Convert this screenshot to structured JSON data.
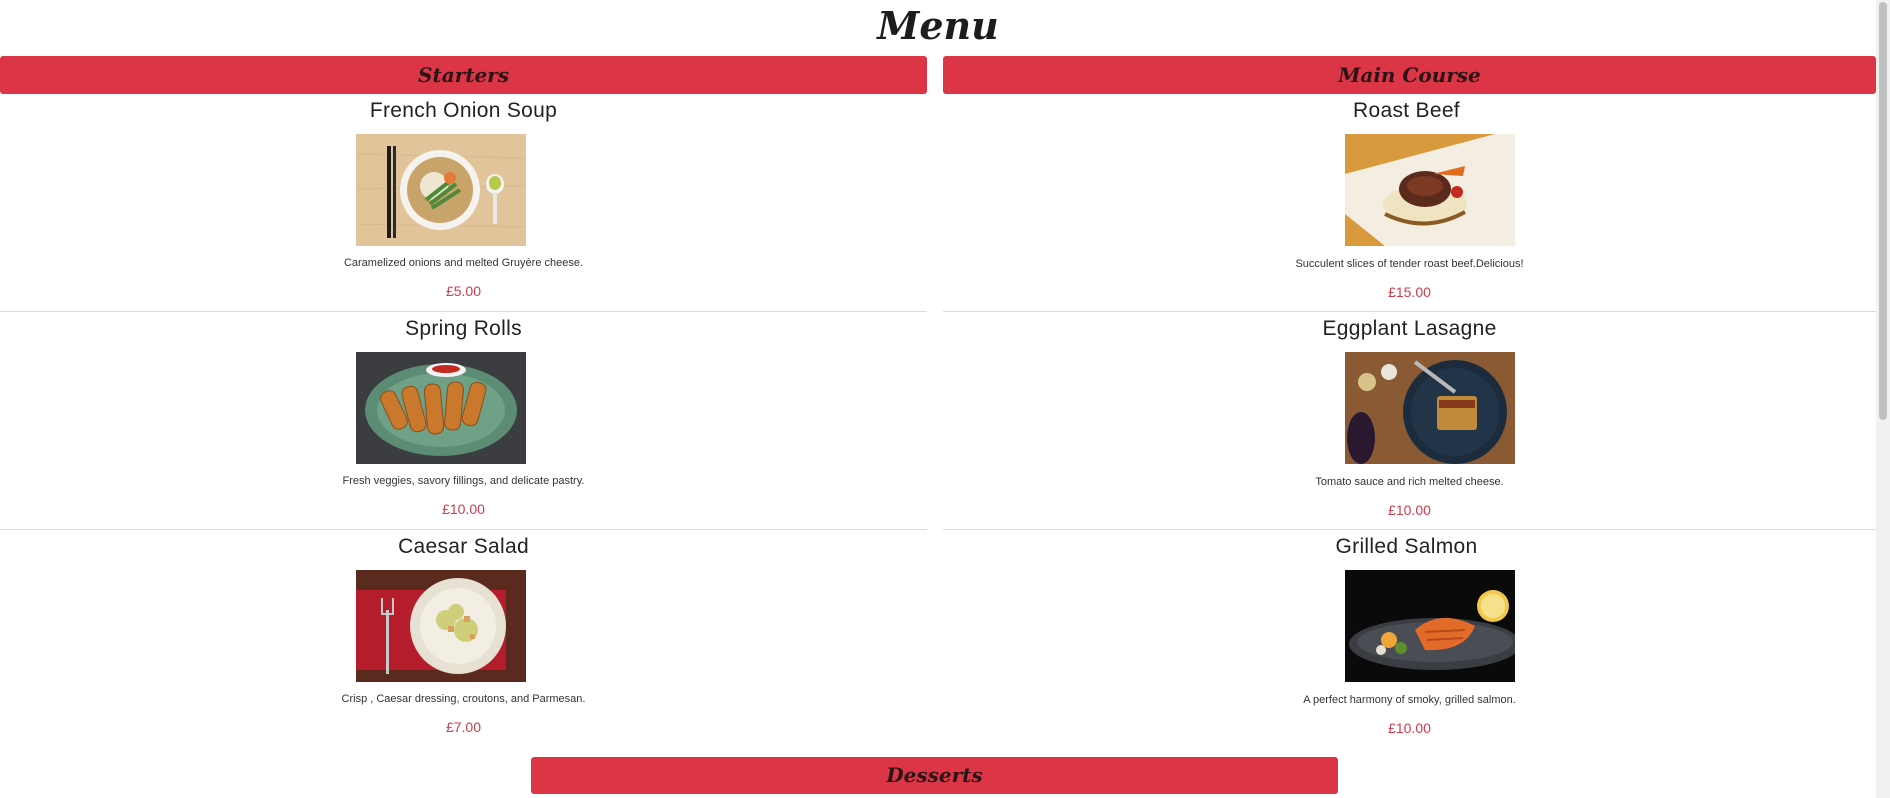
{
  "page": {
    "title": "Menu"
  },
  "sections": {
    "starters": {
      "title": "Starters",
      "items": [
        {
          "name": "French Onion Soup",
          "description": "Caramelized onions and melted Gruyère cheese.",
          "price": "£5.00",
          "photo": "bowl-of-noodle-soup-photo"
        },
        {
          "name": "Spring Rolls",
          "description": "Fresh veggies, savory fillings, and delicate pastry.",
          "price": "£10.00",
          "photo": "plate-of-spring-rolls-photo"
        },
        {
          "name": "Caesar Salad",
          "description": "Crisp , Caesar dressing, croutons, and Parmesan.",
          "price": "£7.00",
          "photo": "plate-of-caesar-salad-photo"
        }
      ]
    },
    "main_course": {
      "title": "Main Course",
      "items": [
        {
          "name": "Roast Beef",
          "description": "Succulent slices of tender roast beef.Delicious!",
          "price": "£15.00",
          "photo": "plated-roast-beef-photo"
        },
        {
          "name": "Eggplant Lasagne",
          "description": "Tomato sauce and rich melted cheese.",
          "price": "£10.00",
          "photo": "eggplant-lasagne-dish-photo"
        },
        {
          "name": "Grilled Salmon",
          "description": "A perfect harmony of smoky, grilled salmon.",
          "price": "£10.00",
          "photo": "grilled-salmon-plate-photo"
        }
      ]
    },
    "desserts": {
      "title": "Desserts"
    }
  },
  "colors": {
    "accent": "#dc3545",
    "price": "#d23a4b",
    "divider": "#dcdcdc"
  }
}
